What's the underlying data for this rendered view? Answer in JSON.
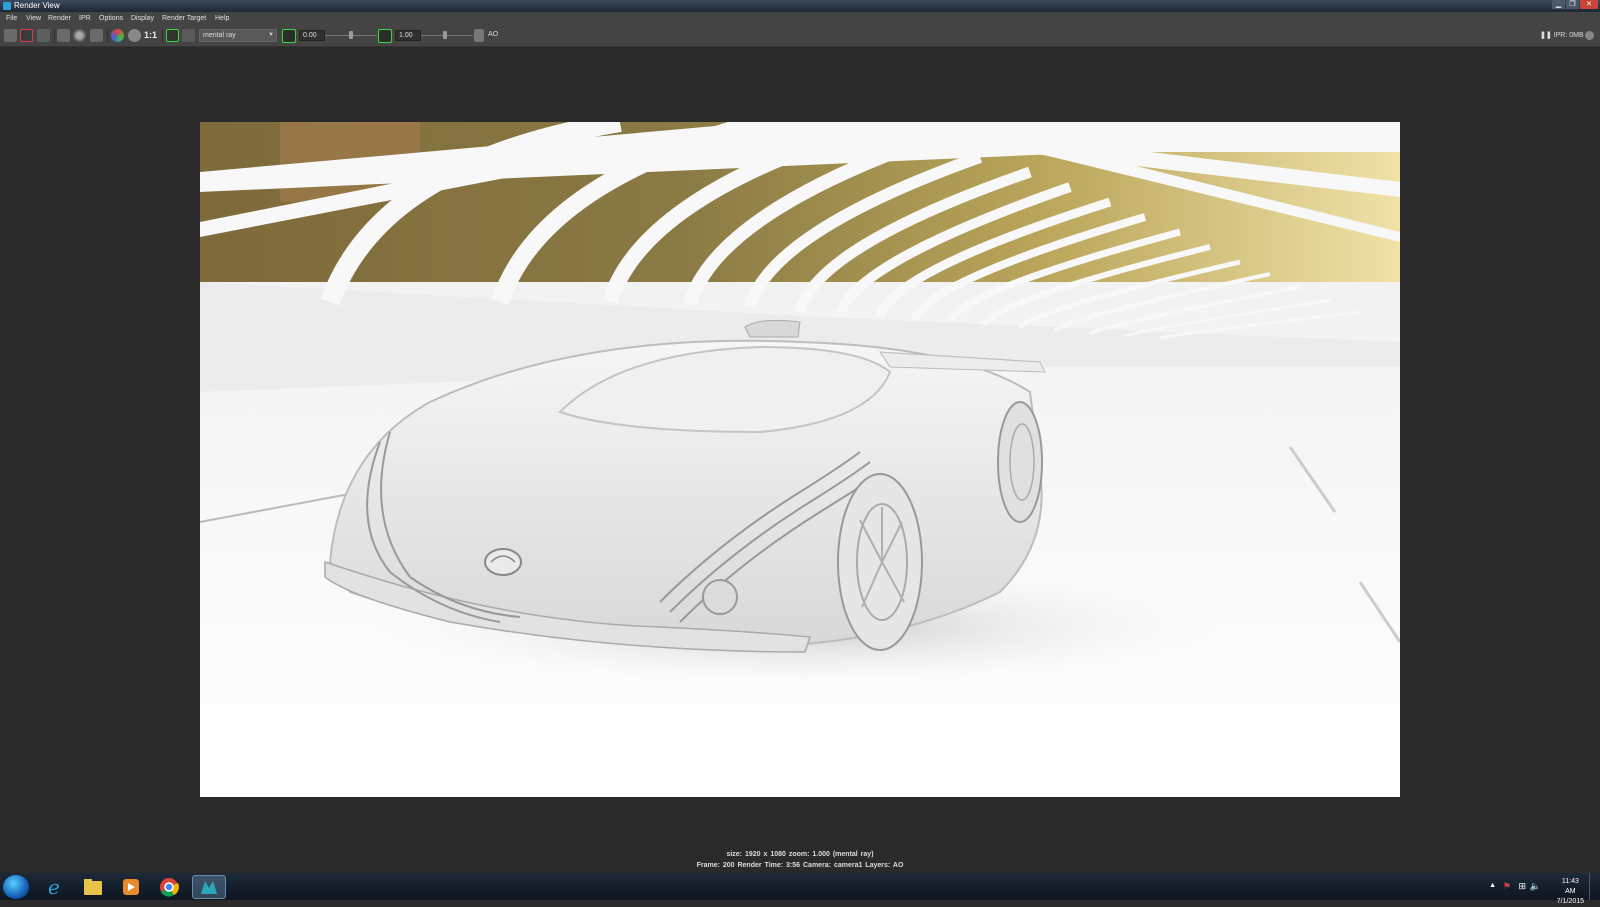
{
  "window": {
    "title": "Render View",
    "controls": [
      "minimize",
      "maximize",
      "close"
    ]
  },
  "menu": [
    "File",
    "View",
    "Render",
    "IPR",
    "Options",
    "Display",
    "Render Target",
    "Help"
  ],
  "toolbar": {
    "ratio_label": "1:1",
    "renderer": "mental ray",
    "exposure_value": "0.00",
    "gamma_value": "1.00",
    "layer_label": "AO",
    "ipr_memory": "IPR: 0MB"
  },
  "status": {
    "line1": "size: 1920 x 1080 zoom: 1.000      (mental ray)",
    "line2": "Frame: 200      Render Time:  3:56      Camera: camera1      Layers: AO"
  },
  "taskbar": {
    "apps": [
      "windows-start",
      "internet-explorer",
      "file-explorer",
      "media-player",
      "chrome",
      "maya"
    ],
    "time": "11:43 AM",
    "date": "7/1/2015"
  },
  "render": {
    "subject": "car",
    "brand_logo": "mazda-logo-icon"
  },
  "colors": {
    "background": "#2a2a2a",
    "toolbar": "#444444",
    "accent_green": "#3ad83a"
  }
}
